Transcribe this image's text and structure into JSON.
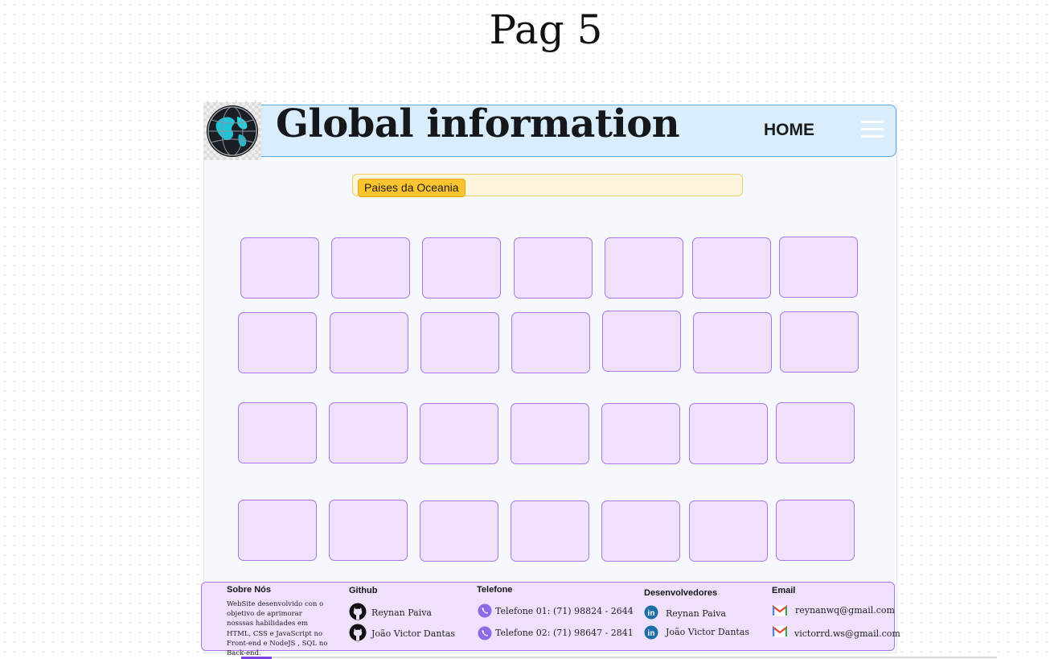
{
  "page_title": "Pag 5",
  "header": {
    "brand": "Global information",
    "nav_home": "HOME",
    "menu_icon": "hamburger-menu-icon",
    "logo_icon": "globe-icon"
  },
  "search": {
    "chip_label": "Paises da Oceania"
  },
  "colors": {
    "header_bg": "#d9edfc",
    "card_bg": "#efe1fc",
    "card_border": "#a878e6",
    "chip": "#fcc52f"
  },
  "footer": {
    "about": {
      "title": "Sobre Nós",
      "text": "WebSite desenvolvido con o objetivo de aprimorar nosssas habilidades em HTML, CSS e JavaScript no Front-end e NodeJS , SQL no Back-end."
    },
    "github": {
      "title": "Github",
      "items": [
        "Reynan Paiva",
        "João Victor Dantas"
      ]
    },
    "phone": {
      "title": "Telefone",
      "items": [
        "Telefone 01: (71) 98824 - 2644",
        "Telefone 02: (71) 98647 - 2841"
      ]
    },
    "devs": {
      "title": "Desenvolvedores",
      "items": [
        "Reynan Paiva",
        "João Victor Dantas"
      ]
    },
    "email": {
      "title": "Email",
      "items": [
        "reynanwq@gmail.com",
        "victorrd.ws@gmail.com"
      ]
    }
  }
}
